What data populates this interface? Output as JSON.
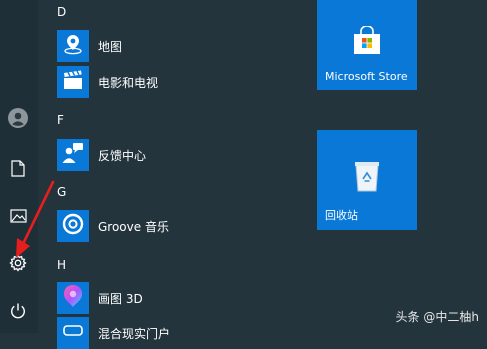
{
  "sections": [
    {
      "letter": "D",
      "apps": [
        {
          "label": "地图",
          "icon": "map-pin-icon",
          "color": "#0a78d7"
        },
        {
          "label": "电影和电视",
          "icon": "clapperboard-icon",
          "color": "#0a78d7"
        }
      ]
    },
    {
      "letter": "F",
      "apps": [
        {
          "label": "反馈中心",
          "icon": "feedback-people-icon",
          "color": "#0a78d7"
        }
      ]
    },
    {
      "letter": "G",
      "apps": [
        {
          "label": "Groove 音乐",
          "icon": "groove-disc-icon",
          "color": "#0a78d7"
        }
      ]
    },
    {
      "letter": "H",
      "apps": [
        {
          "label": "画图 3D",
          "icon": "paint3d-icon",
          "color": "#0a78d7"
        },
        {
          "label": "混合现实门户",
          "icon": "mixed-reality-icon",
          "color": "#0a78d7"
        }
      ]
    }
  ],
  "tiles": [
    {
      "label": "Microsoft Store",
      "icon": "store-bag-icon",
      "color": "#0a78d7"
    },
    {
      "label": "回收站",
      "icon": "recycle-bin-icon",
      "color": "#0a78d7"
    }
  ],
  "rail": {
    "items": [
      "user-avatar-icon",
      "document-icon",
      "pictures-icon",
      "settings-gear-icon",
      "power-icon"
    ],
    "highlighted": "settings-gear-icon",
    "arrow_color": "#e81e1e"
  },
  "watermark": {
    "source": "头条",
    "handle": "@中二柚h"
  }
}
